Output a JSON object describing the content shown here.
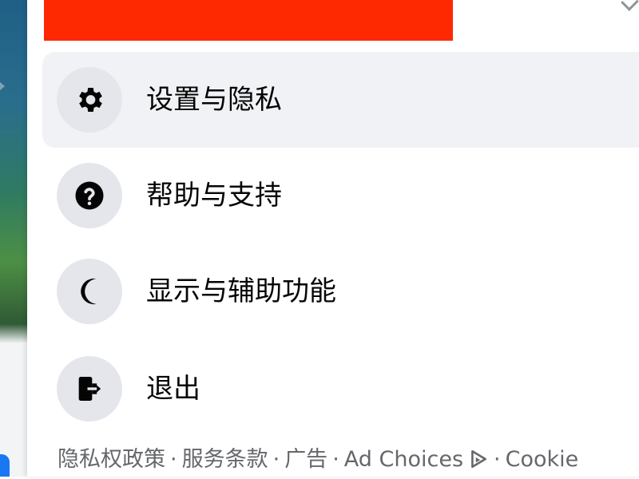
{
  "menu": {
    "items": [
      {
        "label": "设置与隐私",
        "icon": "gear-icon",
        "active": true,
        "has_chevron": true
      },
      {
        "label": "帮助与支持",
        "icon": "question-icon",
        "active": false,
        "has_chevron": true
      },
      {
        "label": "显示与辅助功能",
        "icon": "moon-icon",
        "active": false,
        "has_chevron": true
      },
      {
        "label": "退出",
        "icon": "logout-icon",
        "active": false,
        "has_chevron": false
      }
    ]
  },
  "footer": {
    "links": [
      {
        "label": "隐私权政策"
      },
      {
        "label": "服务条款"
      },
      {
        "label": "广告"
      },
      {
        "label": "Ad Choices"
      },
      {
        "label": "Cookie"
      }
    ],
    "separator": "·"
  },
  "colors": {
    "redaction": "#fe2900",
    "active_bg": "#f0f2f5",
    "icon_circle": "#e4e6eb",
    "text": "#050505",
    "muted_text": "#65676b"
  }
}
